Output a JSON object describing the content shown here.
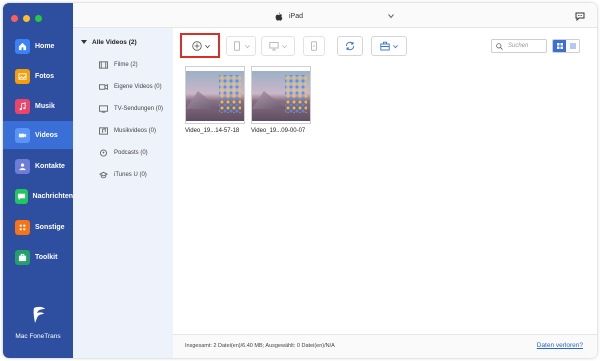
{
  "app": {
    "name": "Mac FoneTrans"
  },
  "titlebar": {
    "device_name": "iPad"
  },
  "sidebar": {
    "items": [
      {
        "label": "Home",
        "icon": "home-icon",
        "color": "#3b82f6"
      },
      {
        "label": "Fotos",
        "icon": "photo-icon",
        "color": "#f59e0b"
      },
      {
        "label": "Musik",
        "icon": "music-icon",
        "color": "#ef4469"
      },
      {
        "label": "Videos",
        "icon": "video-icon",
        "color": "#3b82f6",
        "active": true
      },
      {
        "label": "Kontakte",
        "icon": "contacts-icon",
        "color": "#6b7dd8"
      },
      {
        "label": "Nachrichten",
        "icon": "messages-icon",
        "color": "#22c55e"
      },
      {
        "label": "Sonstige",
        "icon": "other-icon",
        "color": "#f97316"
      },
      {
        "label": "Toolkit",
        "icon": "toolkit-icon",
        "color": "#22a06b"
      }
    ]
  },
  "categories": {
    "header": "Alle Videos (2)",
    "items": [
      {
        "label": "Filme (2)",
        "icon": "film-icon"
      },
      {
        "label": "Eigene Videos (0)",
        "icon": "home-video-icon"
      },
      {
        "label": "TV-Sendungen (0)",
        "icon": "tv-icon"
      },
      {
        "label": "Musikvideos (0)",
        "icon": "music-video-icon"
      },
      {
        "label": "Podcasts (0)",
        "icon": "podcast-icon"
      },
      {
        "label": "iTunes U (0)",
        "icon": "itunes-u-icon"
      }
    ]
  },
  "toolbar": {
    "search_placeholder": "Suchen",
    "buttons": [
      "add-icon",
      "export-device-icon",
      "export-pc-icon",
      "delete-icon",
      "convert-icon",
      "toolbox-icon"
    ]
  },
  "videos": [
    {
      "caption": "Video_19...14-57-18"
    },
    {
      "caption": "Video_19...09-00-07"
    }
  ],
  "status": {
    "summary": "Insgesamt: 2 Datei(en)/6.40 MB; Ausgewählt: 0 Datei(en)/N/A",
    "link": "Daten verloren?"
  },
  "colors": {
    "sidebar_bg": "#2e4fa0",
    "active_item": "#3a6fd8",
    "accent": "#2a64d4",
    "highlight_border": "#d93025"
  }
}
